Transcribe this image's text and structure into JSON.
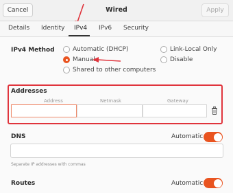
{
  "header": {
    "cancel_label": "Cancel",
    "title": "Wired",
    "apply_label": "Apply"
  },
  "tabs": [
    {
      "label": "Details"
    },
    {
      "label": "Identity"
    },
    {
      "label": "IPv4",
      "active": true
    },
    {
      "label": "IPv6"
    },
    {
      "label": "Security"
    }
  ],
  "ipv4": {
    "method_label": "IPv4 Method",
    "options": [
      {
        "label": "Automatic (DHCP)",
        "checked": false
      },
      {
        "label": "Manual",
        "checked": true
      },
      {
        "label": "Shared to other computers",
        "checked": false
      },
      {
        "label": "Link-Local Only",
        "checked": false
      },
      {
        "label": "Disable",
        "checked": false
      }
    ]
  },
  "addresses": {
    "heading": "Addresses",
    "columns": [
      "Address",
      "Netmask",
      "Gateway"
    ],
    "values": [
      "",
      "",
      ""
    ]
  },
  "dns": {
    "heading": "DNS",
    "auto_label": "Automatic",
    "auto_enabled": true,
    "value": "",
    "hint": "Separate IP addresses with commas"
  },
  "routes": {
    "heading": "Routes",
    "auto_label": "Automatic",
    "auto_enabled": true
  },
  "colors": {
    "accent": "#e95420",
    "annotation_red": "#e0343c"
  }
}
